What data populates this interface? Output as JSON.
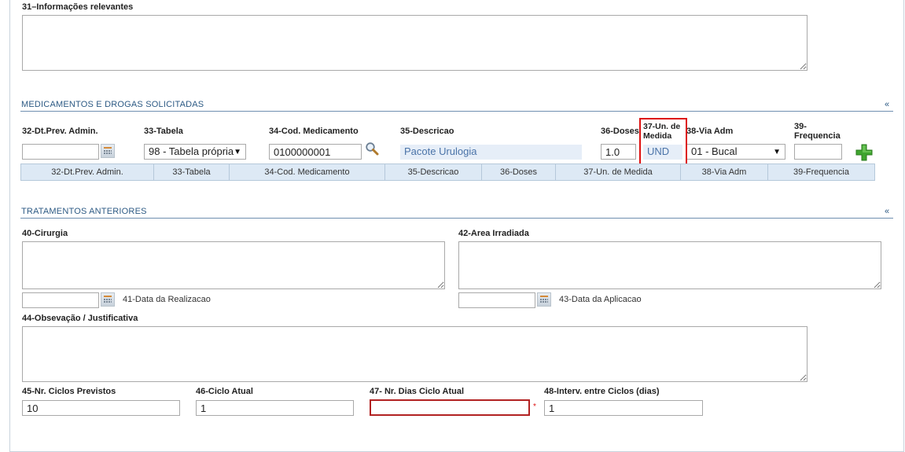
{
  "info": {
    "label": "31–Informações relevantes",
    "value": ""
  },
  "medicamentos": {
    "section_title": "MEDICAMENTOS E DROGAS SOLICITADAS",
    "collapse_glyph": "«",
    "labels": {
      "dt_prev": "32-Dt.Prev. Admin.",
      "tabela": "33-Tabela",
      "cod_medicamento": "34-Cod. Medicamento",
      "descricao": "35-Descricao",
      "doses": "36-Doses",
      "un_medida": "37-Un. de Medida",
      "via_adm": "38-Via Adm",
      "frequencia": "39-Frequencia"
    },
    "values": {
      "dt_prev": "",
      "tabela": "98 - Tabela própria",
      "cod_medicamento": "0100000001",
      "descricao": "Pacote Urulogia",
      "doses": "1.0",
      "un_medida": "UND",
      "via_adm": "01 - Bucal",
      "frequencia": ""
    },
    "grid_columns": [
      "32-Dt.Prev. Admin.",
      "33-Tabela",
      "34-Cod. Medicamento",
      "35-Descricao",
      "36-Doses",
      "37-Un. de Medida",
      "38-Via Adm",
      "39-Frequencia"
    ],
    "accent_color": "#2d5a84",
    "highlight_color": "#dd1111"
  },
  "tratamentos": {
    "section_title": "TRATAMENTOS ANTERIORES",
    "collapse_glyph": "«",
    "cirurgia_label": "40-Cirurgia",
    "area_irradiada_label": "42-Area Irradiada",
    "data_realizacao_label": "41-Data da Realizacao",
    "data_aplicacao_label": "43-Data da Aplicacao",
    "observacao_label": "44-Obsevação / Justificativa",
    "ciclos_previstos_label": "45-Nr. Ciclos Previstos",
    "ciclo_atual_label": "46-Ciclo Atual",
    "dias_ciclo_label": "47- Nr. Dias Ciclo Atual",
    "interv_label": "48-Interv. entre Ciclos (dias)",
    "ciclos_previstos_value": "10",
    "ciclo_atual_value": "1",
    "dias_ciclo_value": "",
    "interv_value": "1",
    "required_marker": "*"
  },
  "icons": {
    "calendar": "calendar-icon",
    "search": "search-icon",
    "add": "plus-icon"
  }
}
